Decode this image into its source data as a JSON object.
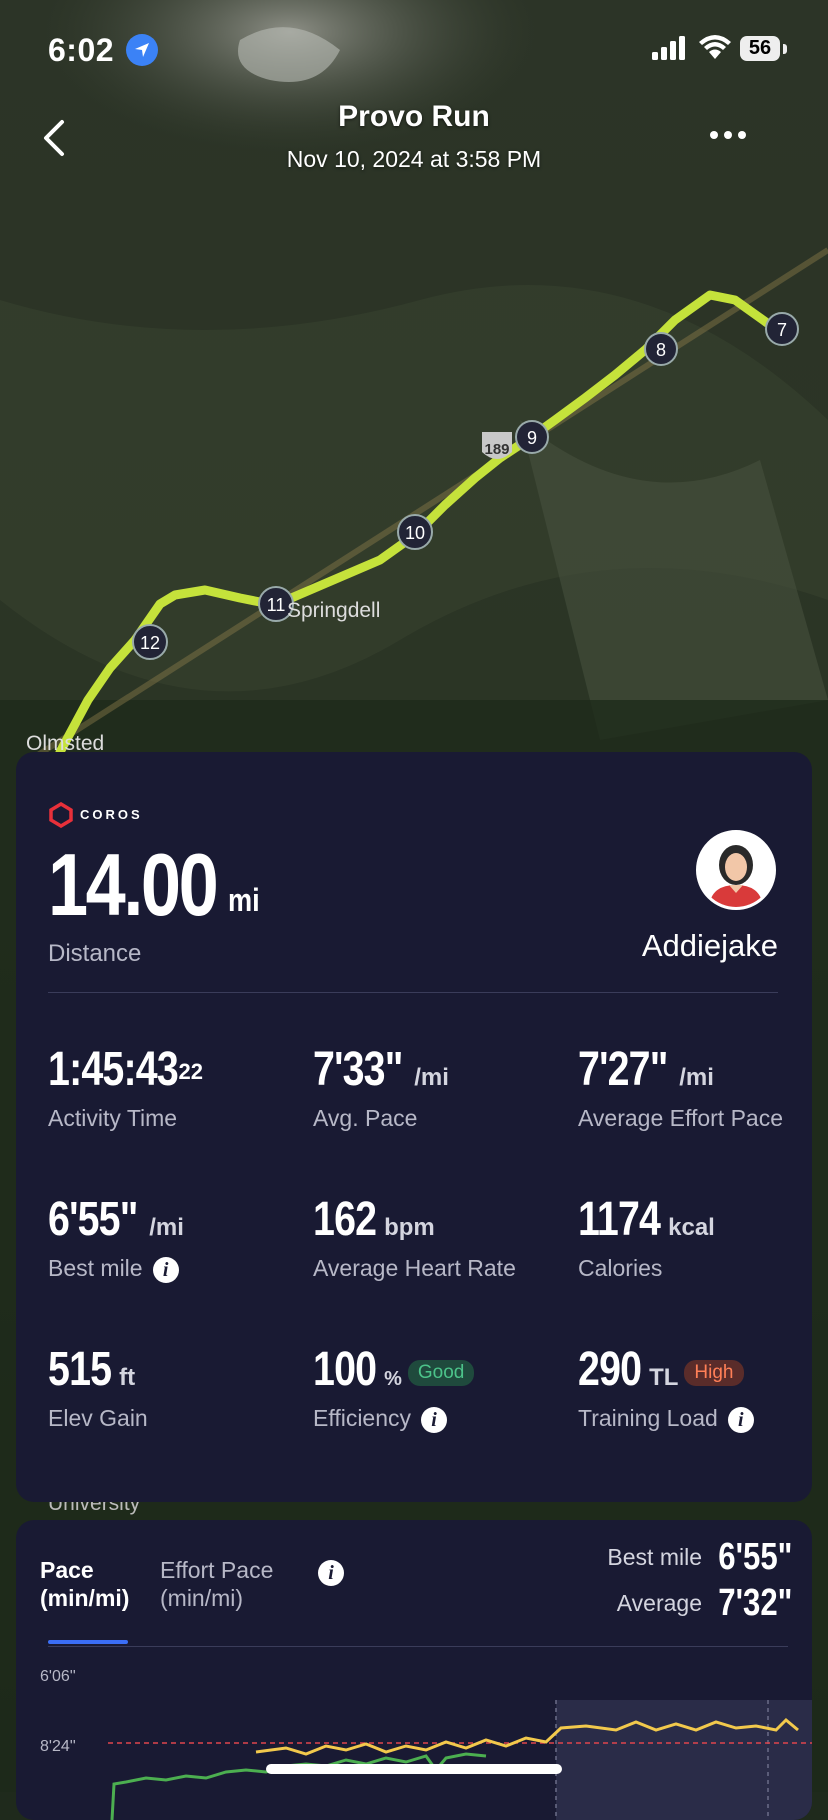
{
  "status_bar": {
    "time": "6:02",
    "battery": "56"
  },
  "header": {
    "title": "Provo Run",
    "subtitle": "Nov 10, 2024 at 3:58 PM"
  },
  "map": {
    "mile_markers": [
      "7",
      "8",
      "9",
      "10",
      "11",
      "12"
    ],
    "place_labels": {
      "springdell": "Springdell",
      "olmsted": "Olmsted",
      "university": "University",
      "route_shield": "189"
    }
  },
  "summary": {
    "brand": "COROS",
    "distance": {
      "value": "14.00",
      "unit": "mi",
      "label": "Distance"
    },
    "username": "Addiejake",
    "metrics": [
      {
        "value": "1:45:43",
        "sup": "22",
        "unit": "",
        "label": "Activity Time"
      },
      {
        "value": "7'33\"",
        "unit": "/mi",
        "label": "Avg. Pace"
      },
      {
        "value": "7'27\"",
        "unit": "/mi",
        "label": "Average Effort Pace"
      },
      {
        "value": "6'55\"",
        "unit": "/mi",
        "label": "Best mile"
      },
      {
        "value": "162",
        "unit": "bpm",
        "label": "Average Heart Rate"
      },
      {
        "value": "1174",
        "unit": "kcal",
        "label": "Calories"
      },
      {
        "value": "515",
        "unit": "ft",
        "label": "Elev Gain"
      },
      {
        "value": "100",
        "unit": "%",
        "badge": "Good",
        "label": "Efficiency"
      },
      {
        "value": "290",
        "unit": "TL",
        "badge": "High",
        "label": "Training Load"
      }
    ]
  },
  "pace_chart": {
    "tabs": [
      {
        "label": "Pace\n(min/mi)"
      },
      {
        "label": "Effort Pace\n(min/mi)"
      }
    ],
    "best_mile_label": "Best mile",
    "best_mile_value": "6'55\"",
    "average_label": "Average",
    "average_value": "7'32\"",
    "y_ticks": [
      "6'06''",
      "8'24''"
    ]
  },
  "colors": {
    "card_bg": "#191a33",
    "route": "#c5e23b",
    "accent_blue": "#3b6ef5",
    "good": "#4cc38a",
    "high": "#ff7f57"
  }
}
